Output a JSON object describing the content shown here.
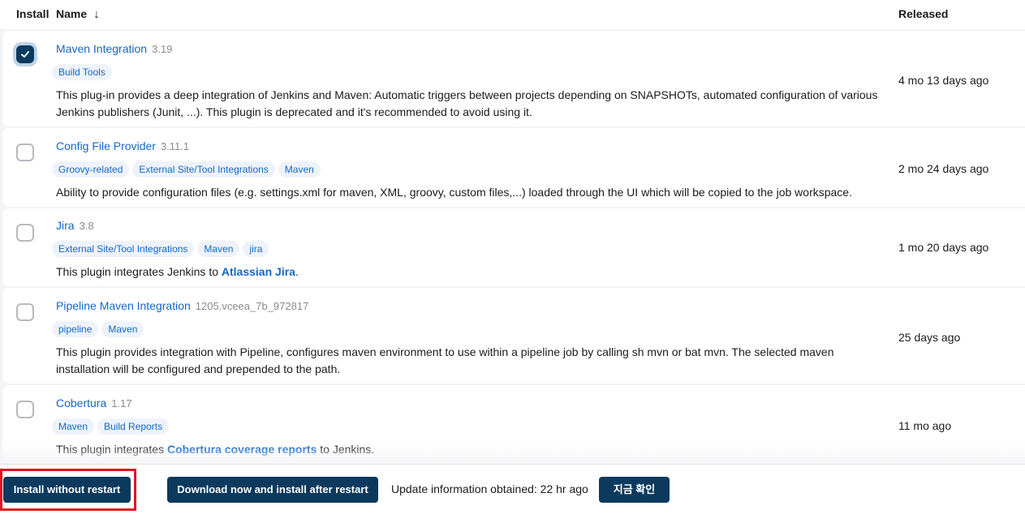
{
  "header": {
    "install_label": "Install",
    "name_label": "Name",
    "sort_arrow": "↓",
    "released_label": "Released"
  },
  "plugins": [
    {
      "name": "Maven Integration",
      "version": "3.19",
      "checked": true,
      "tags": [
        "Build Tools"
      ],
      "description": "This plug-in provides a deep integration of Jenkins and Maven: Automatic triggers between projects depending on SNAPSHOTs, automated configuration of various Jenkins publishers (Junit, ...). This plugin is deprecated and it's recommended to avoid using it.",
      "released": "4 mo 13 days ago"
    },
    {
      "name": "Config File Provider",
      "version": "3.11.1",
      "checked": false,
      "tags": [
        "Groovy-related",
        "External Site/Tool Integrations",
        "Maven"
      ],
      "description": "Ability to provide configuration files (e.g. settings.xml for maven, XML, groovy, custom files,...) loaded through the UI which will be copied to the job workspace.",
      "released": "2 mo 24 days ago"
    },
    {
      "name": "Jira",
      "version": "3.8",
      "checked": false,
      "tags": [
        "External Site/Tool Integrations",
        "Maven",
        "jira"
      ],
      "description_prefix": "This plugin integrates Jenkins to ",
      "description_link": "Atlassian Jira",
      "description_suffix": ".",
      "released": "1 mo 20 days ago"
    },
    {
      "name": "Pipeline Maven Integration",
      "version": "1205.vceea_7b_972817",
      "checked": false,
      "tags": [
        "pipeline",
        "Maven"
      ],
      "description": "This plugin provides integration with Pipeline, configures maven environment to use within a pipeline job by calling sh mvn or bat mvn. The selected maven installation will be configured and prepended to the path.",
      "released": "25 days ago"
    },
    {
      "name": "Cobertura",
      "version": "1.17",
      "checked": false,
      "tags": [
        "Maven",
        "Build Reports"
      ],
      "description_prefix": "This plugin integrates ",
      "description_link": "Cobertura coverage reports",
      "description_suffix": " to Jenkins.",
      "released": "11 mo ago"
    }
  ],
  "footer": {
    "install_without_restart": "Install without restart",
    "download_install_after_restart": "Download now and install after restart",
    "update_info": "Update information obtained: 22 hr ago",
    "check_now": "지금 확인"
  },
  "colors": {
    "primary": "#0b3a5e",
    "link": "#1567c8",
    "highlight": "#e0141f"
  }
}
